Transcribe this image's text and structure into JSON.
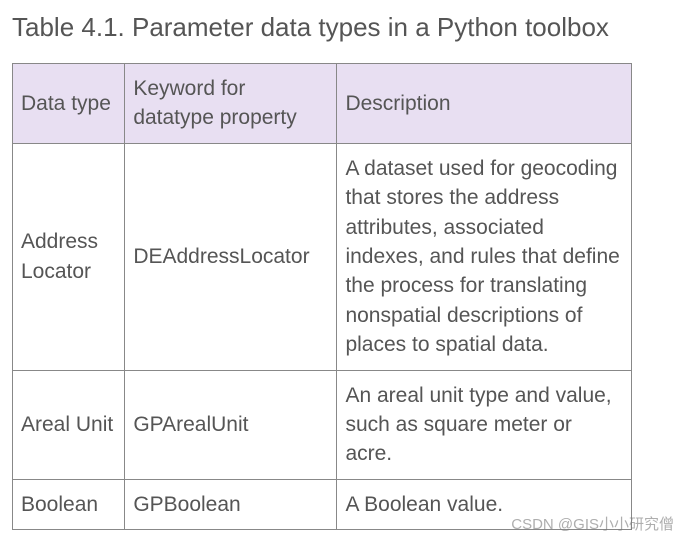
{
  "title": "Table 4.1. Parameter data types in a Python toolbox",
  "headers": {
    "col1": "Data type",
    "col2": "Keyword for datatype property",
    "col3": "Description"
  },
  "rows": [
    {
      "dataType": "Address Locator",
      "keyword": "DEAddressLocator",
      "description": "A dataset used for geocoding that stores the address attributes, associated indexes, and rules that define the process for translating nonspatial descriptions of places to spatial data."
    },
    {
      "dataType": "Areal Unit",
      "keyword": "GPArealUnit",
      "description": "An areal unit type and value, such as square meter or acre."
    },
    {
      "dataType": "Boolean",
      "keyword": "GPBoolean",
      "description": "A Boolean value."
    }
  ],
  "watermark": "CSDN @GIS小小研究僧"
}
